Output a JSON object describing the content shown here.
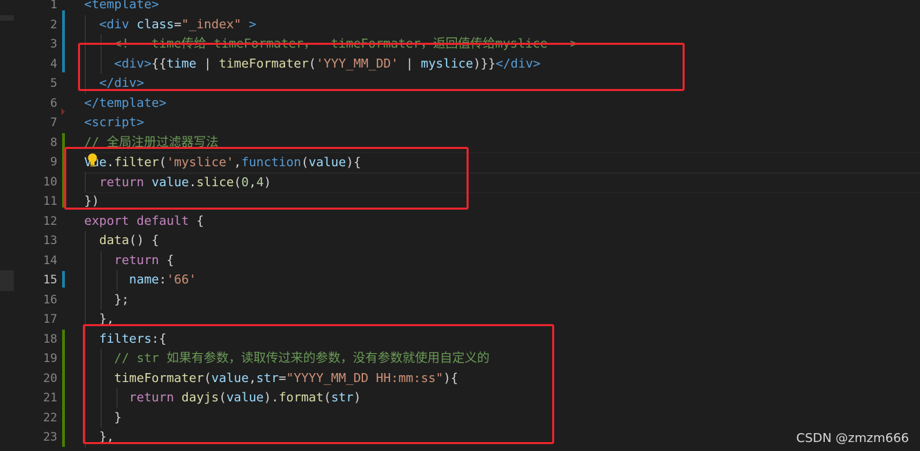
{
  "editor": {
    "language": "vue",
    "line_numbers": [
      "1",
      "2",
      "3",
      "4",
      "5",
      "6",
      "7",
      "8",
      "9",
      "10",
      "11",
      "12",
      "13",
      "14",
      "15",
      "16",
      "17",
      "18",
      "19",
      "20",
      "21",
      "22",
      "23"
    ],
    "active_line": "15",
    "colors": {
      "highlight_box": "#e8252d",
      "background": "#1e1e1e"
    },
    "lines": [
      [
        [
          "tok-tag",
          "<template>"
        ]
      ],
      [
        [
          "tok-txt",
          "  "
        ],
        [
          "tok-tag",
          "<div"
        ],
        [
          "tok-txt",
          " "
        ],
        [
          "tok-attr",
          "class"
        ],
        [
          "tok-txt",
          "="
        ],
        [
          "tok-str",
          "\"_index\""
        ],
        [
          "tok-txt",
          " "
        ],
        [
          "tok-tag",
          ">"
        ]
      ],
      [
        [
          "tok-txt",
          "    "
        ],
        [
          "tok-com",
          "<!-- time传给 timeFormater，  timeFormater，返回值传给myslice -->"
        ]
      ],
      [
        [
          "tok-txt",
          "    "
        ],
        [
          "tok-tag",
          "<div>"
        ],
        [
          "tok-txt",
          "{{"
        ],
        [
          "tok-var",
          "time"
        ],
        [
          "tok-txt",
          " | "
        ],
        [
          "tok-fn",
          "timeFormater"
        ],
        [
          "tok-txt",
          "("
        ],
        [
          "tok-str",
          "'YYY_MM_DD'"
        ],
        [
          "tok-txt",
          " | "
        ],
        [
          "tok-var",
          "myslice"
        ],
        [
          "tok-txt",
          ")}}"
        ],
        [
          "tok-tag",
          "</div>"
        ]
      ],
      [
        [
          "tok-txt",
          "  "
        ],
        [
          "tok-tag",
          "</div>"
        ]
      ],
      [
        [
          "tok-tag",
          "</template>"
        ]
      ],
      [
        [
          "tok-tag",
          "<script>"
        ]
      ],
      [
        [
          "tok-com",
          "// 全局注册过滤器写法"
        ]
      ],
      [
        [
          "tok-var",
          "Vue"
        ],
        [
          "tok-txt",
          "."
        ],
        [
          "tok-fn",
          "filter"
        ],
        [
          "tok-txt",
          "("
        ],
        [
          "tok-str",
          "'myslice'"
        ],
        [
          "tok-txt",
          ","
        ],
        [
          "tok-kw2",
          "function"
        ],
        [
          "tok-txt",
          "("
        ],
        [
          "tok-var",
          "value"
        ],
        [
          "tok-txt",
          "){"
        ]
      ],
      [
        [
          "tok-txt",
          "  "
        ],
        [
          "tok-kw",
          "return"
        ],
        [
          "tok-txt",
          " "
        ],
        [
          "tok-var",
          "value"
        ],
        [
          "tok-txt",
          "."
        ],
        [
          "tok-fn",
          "slice"
        ],
        [
          "tok-txt",
          "("
        ],
        [
          "tok-num",
          "0"
        ],
        [
          "tok-txt",
          ","
        ],
        [
          "tok-num",
          "4"
        ],
        [
          "tok-txt",
          ")"
        ]
      ],
      [
        [
          "tok-txt",
          "})"
        ]
      ],
      [
        [
          "tok-kw",
          "export"
        ],
        [
          "tok-txt",
          " "
        ],
        [
          "tok-kw",
          "default"
        ],
        [
          "tok-txt",
          " {"
        ]
      ],
      [
        [
          "tok-txt",
          "  "
        ],
        [
          "tok-fn",
          "data"
        ],
        [
          "tok-txt",
          "() {"
        ]
      ],
      [
        [
          "tok-txt",
          "    "
        ],
        [
          "tok-kw",
          "return"
        ],
        [
          "tok-txt",
          " {"
        ]
      ],
      [
        [
          "tok-txt",
          "      "
        ],
        [
          "tok-var",
          "name"
        ],
        [
          "tok-txt",
          ":"
        ],
        [
          "tok-str",
          "'66'"
        ]
      ],
      [
        [
          "tok-txt",
          "    };"
        ]
      ],
      [
        [
          "tok-txt",
          "  },"
        ]
      ],
      [
        [
          "tok-txt",
          "  "
        ],
        [
          "tok-var",
          "filters"
        ],
        [
          "tok-txt",
          ":{"
        ]
      ],
      [
        [
          "tok-txt",
          "    "
        ],
        [
          "tok-com",
          "// str 如果有参数，读取传过来的参数，没有参数就使用自定义的"
        ]
      ],
      [
        [
          "tok-txt",
          "    "
        ],
        [
          "tok-fn",
          "timeFormater"
        ],
        [
          "tok-txt",
          "("
        ],
        [
          "tok-var",
          "value"
        ],
        [
          "tok-txt",
          ","
        ],
        [
          "tok-var",
          "str"
        ],
        [
          "tok-txt",
          "="
        ],
        [
          "tok-str",
          "\"YYYY_MM_DD HH:mm:ss\""
        ],
        [
          "tok-txt",
          "){"
        ]
      ],
      [
        [
          "tok-txt",
          "      "
        ],
        [
          "tok-kw",
          "return"
        ],
        [
          "tok-txt",
          " "
        ],
        [
          "tok-fn",
          "dayjs"
        ],
        [
          "tok-txt",
          "("
        ],
        [
          "tok-var",
          "value"
        ],
        [
          "tok-txt",
          ")."
        ],
        [
          "tok-fn",
          "format"
        ],
        [
          "tok-txt",
          "("
        ],
        [
          "tok-var",
          "str"
        ],
        [
          "tok-txt",
          ")"
        ]
      ],
      [
        [
          "tok-txt",
          "    }"
        ]
      ],
      [
        [
          "tok-txt",
          "  },"
        ]
      ]
    ]
  },
  "icons": {
    "lightbulb": "lightbulb-icon",
    "fold": "fold-arrow-icon"
  },
  "watermark": "CSDN @zmzm666"
}
